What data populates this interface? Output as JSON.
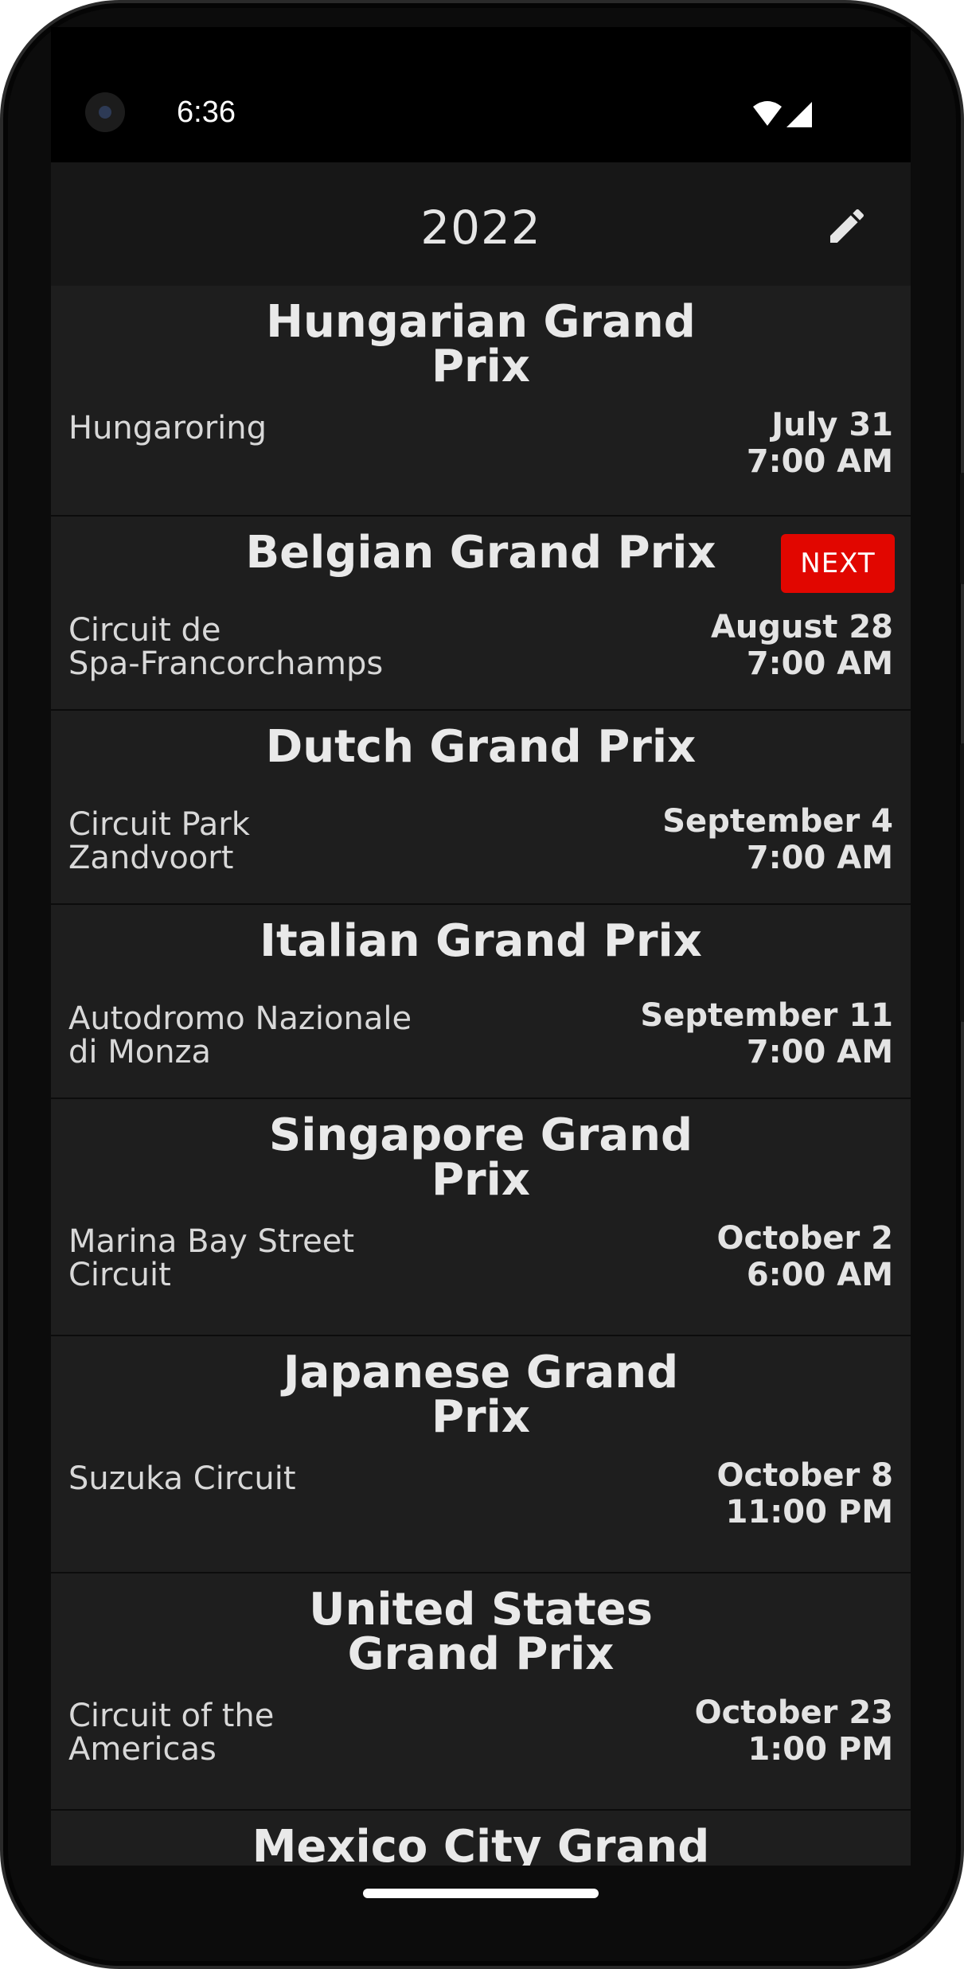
{
  "status": {
    "time": "6:36"
  },
  "header": {
    "title": "2022",
    "edit_icon": "pencil-icon"
  },
  "races": [
    {
      "name_lines": [
        "Hungarian Grand",
        "Prix"
      ],
      "circuit_lines": [
        "Hungaroring"
      ],
      "date": "July 31",
      "time": "7:00 AM",
      "badge": ""
    },
    {
      "name_lines": [
        "Belgian Grand Prix"
      ],
      "circuit_lines": [
        "Circuit de",
        "Spa-Francorchamps"
      ],
      "date": "August 28",
      "time": "7:00 AM",
      "badge": "NEXT"
    },
    {
      "name_lines": [
        "Dutch Grand Prix"
      ],
      "circuit_lines": [
        "Circuit Park",
        "Zandvoort"
      ],
      "date": "September 4",
      "time": "7:00 AM",
      "badge": ""
    },
    {
      "name_lines": [
        "Italian Grand Prix"
      ],
      "circuit_lines": [
        "Autodromo Nazionale",
        "di Monza"
      ],
      "date": "September 11",
      "time": "7:00 AM",
      "badge": ""
    },
    {
      "name_lines": [
        "Singapore Grand",
        "Prix"
      ],
      "circuit_lines": [
        "Marina Bay Street",
        "Circuit"
      ],
      "date": "October 2",
      "time": "6:00 AM",
      "badge": ""
    },
    {
      "name_lines": [
        "Japanese Grand",
        "Prix"
      ],
      "circuit_lines": [
        "Suzuka Circuit"
      ],
      "date": "October 8",
      "time": "11:00 PM",
      "badge": ""
    },
    {
      "name_lines": [
        "United States",
        "Grand Prix"
      ],
      "circuit_lines": [
        "Circuit of the",
        "Americas"
      ],
      "date": "October 23",
      "time": "1:00 PM",
      "badge": ""
    },
    {
      "name_lines": [
        "Mexico City Grand"
      ],
      "circuit_lines": [],
      "date": "",
      "time": "",
      "badge": ""
    }
  ],
  "colors": {
    "background": "#1e1e1e",
    "topbar": "#171717",
    "text": "#e6e6e6",
    "badge": "#e10600"
  }
}
